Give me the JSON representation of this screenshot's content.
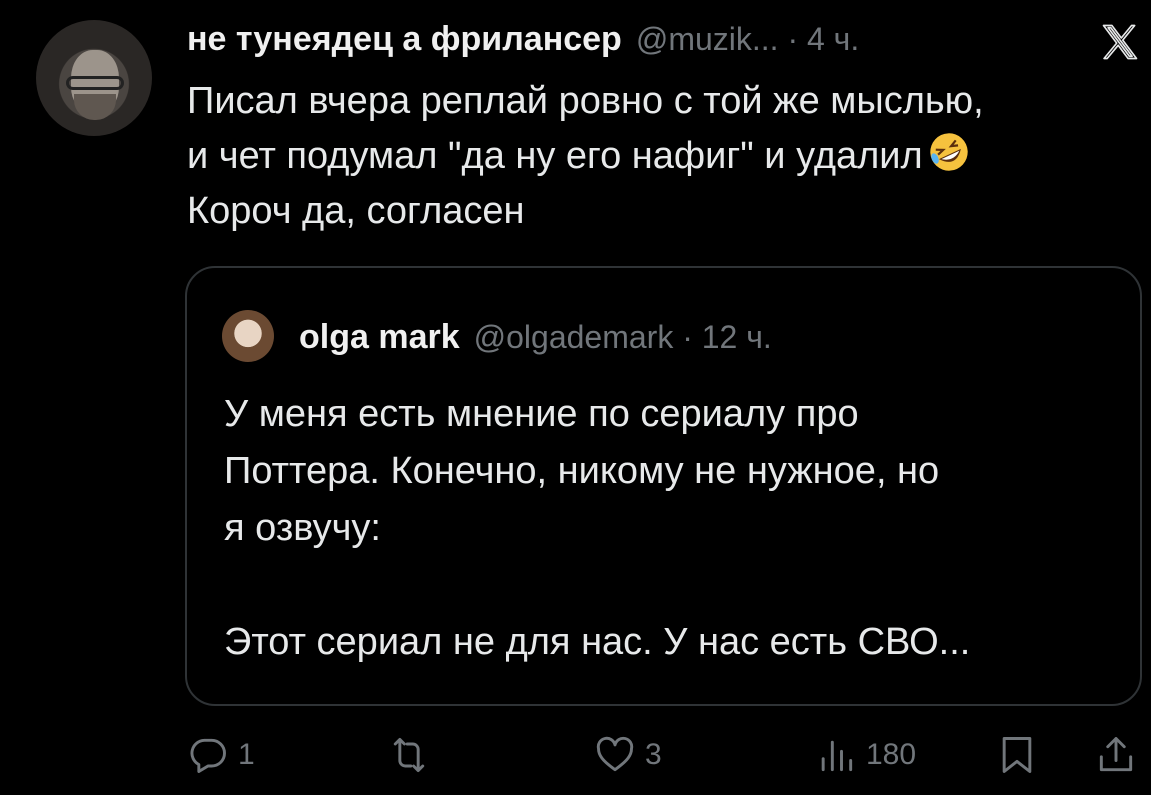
{
  "tweet": {
    "author_name": "не тунеядец а фрилансер",
    "meta": "@muzik... · 4 ч.",
    "lines": [
      "Писал вчера реплай ровно с той же мыслью,",
      "и чет подумал \"да ну его нафиг\" и удалил",
      "Короч да, согласен"
    ],
    "emoji": "rolling-on-floor-laughing"
  },
  "quote": {
    "author_name": "olga mark",
    "meta": "@olgademark · 12 ч.",
    "lines": [
      "У меня есть мнение по сериалу про",
      "Поттера. Конечно, никому не нужное, но",
      "я озвучу:",
      "",
      "Этот сериал не для нас. У нас есть СВО..."
    ]
  },
  "actions": {
    "replies": "1",
    "retweets": "",
    "likes": "3",
    "views": "180"
  },
  "colors": {
    "background": "#000000",
    "text": "#e7e9ea",
    "secondary": "#71767b",
    "border": "#2f3336"
  },
  "icons": [
    "x-logo-icon",
    "reply-icon",
    "retweet-icon",
    "like-icon",
    "views-icon",
    "bookmark-icon",
    "share-icon"
  ]
}
